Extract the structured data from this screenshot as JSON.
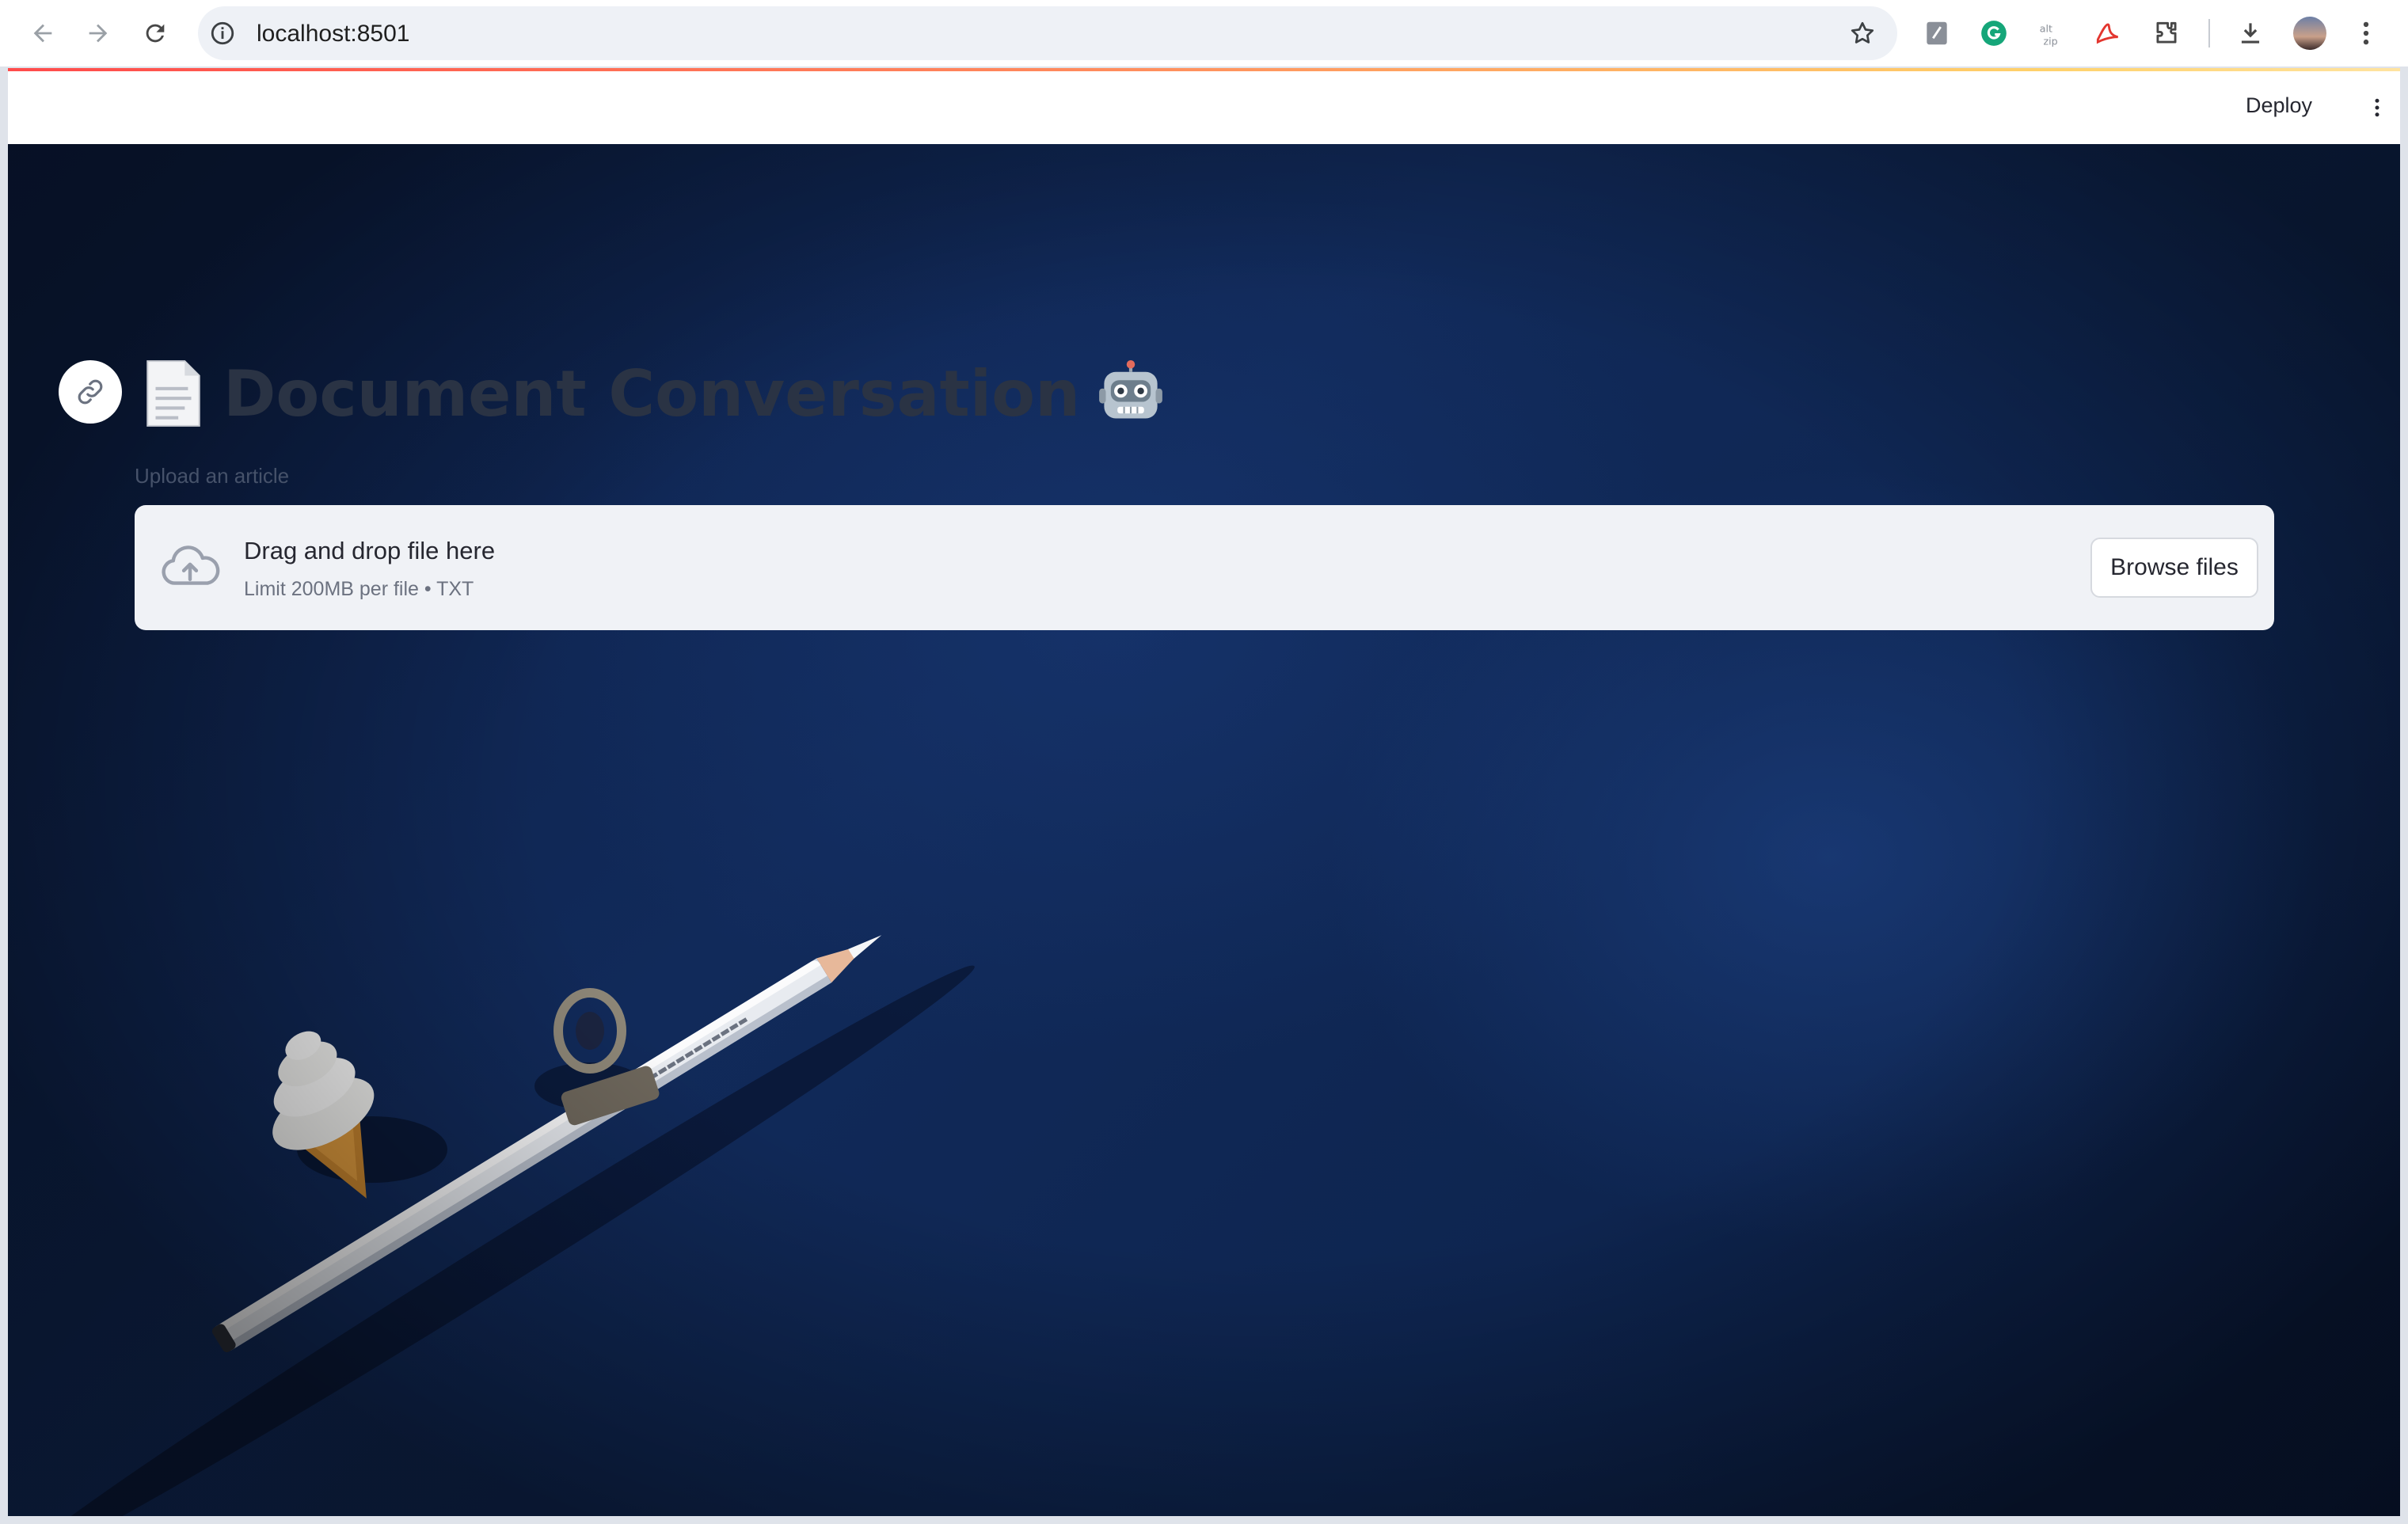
{
  "browser": {
    "url": "localhost:8501",
    "extensions": [
      "notes-icon",
      "grammarly-icon",
      "zip-icon",
      "acrobat-icon",
      "puzzle-extensions-icon"
    ]
  },
  "app": {
    "deploy_label": "Deploy",
    "title": "Document Conversation",
    "title_leading_icon": "page-emoji",
    "title_trailing_icon": "robot-emoji"
  },
  "uploader": {
    "label": "Upload an article",
    "drop_title": "Drag and drop file here",
    "limit_text": "Limit 200MB per file • TXT",
    "browse_label": "Browse files"
  },
  "background": {
    "description_colors": {
      "base": "#0f2552",
      "accent": "#ff4b4b"
    }
  }
}
